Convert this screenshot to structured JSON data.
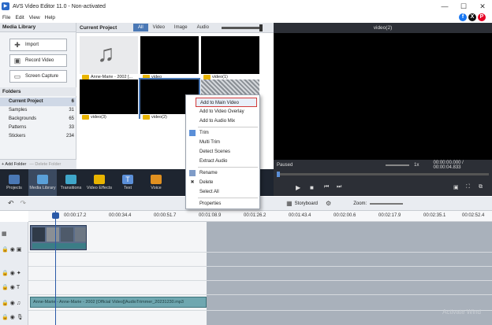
{
  "window": {
    "title": "AVS Video Editor 11.0 - Non-activated",
    "minimize": "—",
    "maximize": "☐",
    "close": "✕"
  },
  "menu": [
    "File",
    "Edit",
    "View",
    "Help"
  ],
  "media_library": {
    "header": "Media Library",
    "buttons": [
      "Import",
      "Record Video",
      "Screen Capture"
    ],
    "folders_header": "Folders",
    "folders": [
      {
        "name": "Current Project",
        "count": "6"
      },
      {
        "name": "Samples",
        "count": "31"
      },
      {
        "name": "Backgrounds",
        "count": "65"
      },
      {
        "name": "Patterns",
        "count": "33"
      },
      {
        "name": "Stickers",
        "count": "234"
      }
    ],
    "add_folder": "+ Add Folder",
    "delete_folder": "— Delete Folder"
  },
  "project": {
    "title": "Current Project",
    "filters": [
      "All",
      "Video",
      "Image",
      "Audio"
    ],
    "items": [
      {
        "label": "Anne-Marie - 2002 [..."
      },
      {
        "label": "video"
      },
      {
        "label": "video(1)"
      },
      {
        "label": "video(3)"
      },
      {
        "label": "video(2)"
      },
      {
        "label": ""
      }
    ]
  },
  "preview": {
    "title": "video(2)",
    "status": "Paused",
    "speed": "1x",
    "time": "00:00:00.000 / 00:00:04.833"
  },
  "tools": [
    {
      "label": "Projects",
      "color": "#4a78b5"
    },
    {
      "label": "Media Library",
      "color": "#5aa0d8"
    },
    {
      "label": "Transitions",
      "color": "#3fa6c9"
    },
    {
      "label": "Video Effects",
      "color": "#e8b400"
    },
    {
      "label": "Text",
      "color": "#5b8fd8"
    },
    {
      "label": "Voice",
      "color": "#e09020"
    }
  ],
  "timeline": {
    "storyboard": "Storyboard",
    "zoom_label": "Zoom:",
    "ruler": [
      "00:00:17.2",
      "00:00:34.4",
      "00:00:51.7",
      "00:01:08.9",
      "00:01:26.2",
      "00:01:43.4",
      "00:02:00.6",
      "00:02:17.9",
      "00:02:35.1",
      "00:02:52.4"
    ],
    "audio_clip_label": "Anne-Marie - Anne-Marie - 2002 [Official Video][AudioTrimmer_20231230.mp3"
  },
  "context_menu": {
    "items": [
      "Add to Main Video",
      "Add to Video Overlay",
      "Add to Audio Mix",
      "Trim",
      "Multi Trim",
      "Detect Scenes",
      "Extract Audio",
      "Rename",
      "Delete",
      "Select All",
      "Properties"
    ]
  },
  "watermark": "Activate Wind"
}
